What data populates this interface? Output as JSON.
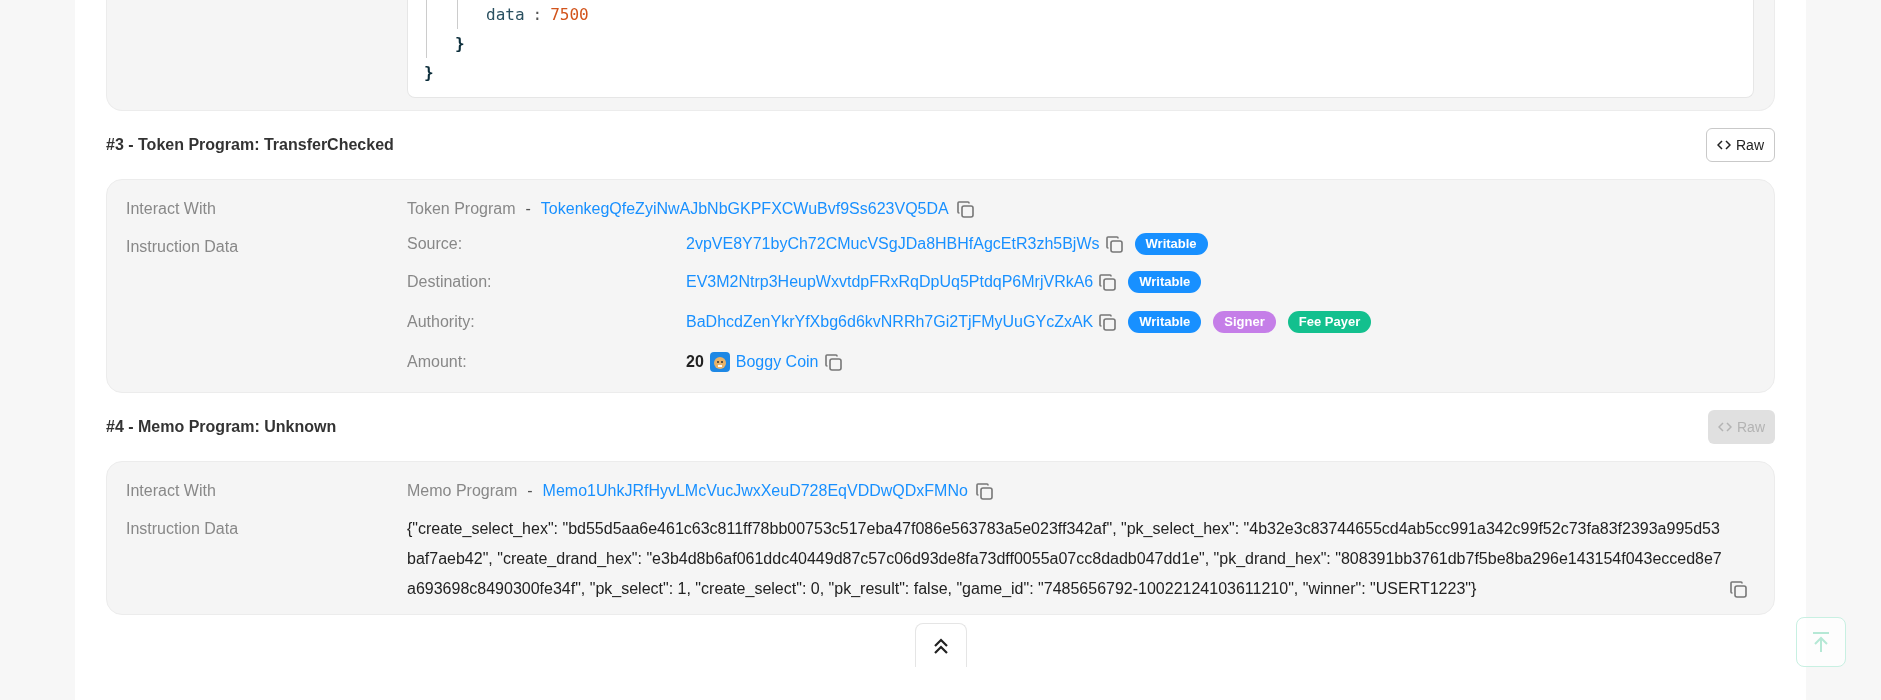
{
  "code_block": {
    "close": "}",
    "children": [
      {
        "close": "}",
        "children": [
          {
            "key": "data",
            "sep": ":",
            "value": "7500"
          }
        ]
      }
    ]
  },
  "instructions": [
    {
      "title": "#3 - Token Program: TransferChecked",
      "raw_button": {
        "label": "Raw",
        "disabled": false
      },
      "interact_label": "Interact With",
      "program_name": "Token Program",
      "dash": "-",
      "program_address": "TokenkegQfeZyiNwAJbNbGKPFXCWuBvf9Ss623VQ5DA",
      "data_label": "Instruction Data",
      "kind": "fields",
      "fields": [
        {
          "kind": "account",
          "label": "Source:",
          "value": "2vpVE8Y71byCh72CMucVSgJDa8HBHfAgcEtR3zh5BjWs",
          "badges": [
            {
              "label": "Writable",
              "color": "#1890ff"
            }
          ]
        },
        {
          "kind": "account",
          "label": "Destination:",
          "value": "EV3M2Ntrp3HeupWxvtdpFRxRqDpUq5PtdqP6MrjVRkA6",
          "badges": [
            {
              "label": "Writable",
              "color": "#1890ff"
            }
          ]
        },
        {
          "kind": "account",
          "label": "Authority:",
          "value": "BaDhcdZenYkrYfXbg6d6kvNRRh7Gi2TjFMyUuGYcZxAK",
          "badges": [
            {
              "label": "Writable",
              "color": "#1890ff"
            },
            {
              "label": "Signer",
              "color": "#c57ee8"
            },
            {
              "label": "Fee Payer",
              "color": "#13c08e"
            }
          ]
        },
        {
          "kind": "amount",
          "label": "Amount:",
          "amount": "20",
          "token": "Boggy Coin"
        }
      ]
    },
    {
      "title": "#4 - Memo Program: Unknown",
      "raw_button": {
        "label": "Raw",
        "disabled": true
      },
      "interact_label": "Interact With",
      "program_name": "Memo Program",
      "dash": "-",
      "program_address": "Memo1UhkJRfHyvLMcVucJwxXeuD728EqVDDwQDxFMNo",
      "data_label": "Instruction Data",
      "kind": "text",
      "text": "{\"create_select_hex\": \"bd55d5aa6e461c63c811ff78bb00753c517eba47f086e563783a5e023ff342af\", \"pk_select_hex\": \"4b32e3c83744655cd4ab5cc991a342c99f52c73fa83f2393a995d53baf7aeb42\", \"create_drand_hex\": \"e3b4d8b6af061ddc40449d87c57c06d93de8fa73dff0055a07cc8dadb047dd1e\", \"pk_drand_hex\": \"808391bb3761db7f5be8ba296e143154f043ecced8e7a693698c8490300fe34f\", \"pk_select\": 1, \"create_select\": 0, \"pk_result\": false, \"game_id\": \"7485656792-10022124103611210\", \"winner\": \"USERT1223\"}"
    }
  ]
}
